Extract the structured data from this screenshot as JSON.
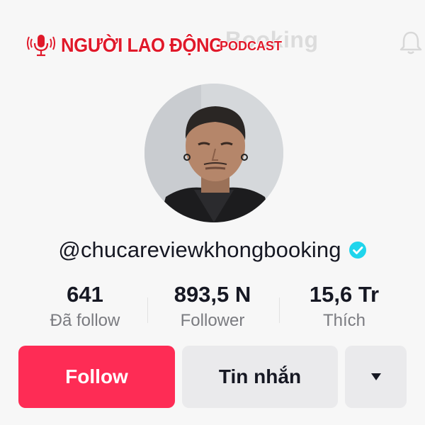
{
  "header": {
    "ghost_title": "chucareviewkhongbooking",
    "ghost_title_visible": "Booking",
    "bell_icon": "bell-icon"
  },
  "watermark": {
    "brand": "NGƯỜI LAO ĐỘNG",
    "suffix": "PODCAST",
    "icon": "microphone-broadcast-icon",
    "color": "#e0192a"
  },
  "profile": {
    "avatar_icon": "profile-avatar",
    "username": "@chucareviewkhongbooking",
    "verified_icon": "verified-badge-icon",
    "verified_color": "#20d5ec"
  },
  "stats": [
    {
      "value": "641",
      "label": "Đã follow"
    },
    {
      "value": "893,5 N",
      "label": "Follower"
    },
    {
      "value": "15,6 Tr",
      "label": "Thích"
    }
  ],
  "actions": {
    "follow_label": "Follow",
    "message_label": "Tin nhắn",
    "more_icon": "caret-down-icon",
    "follow_color": "#fe2c55"
  }
}
